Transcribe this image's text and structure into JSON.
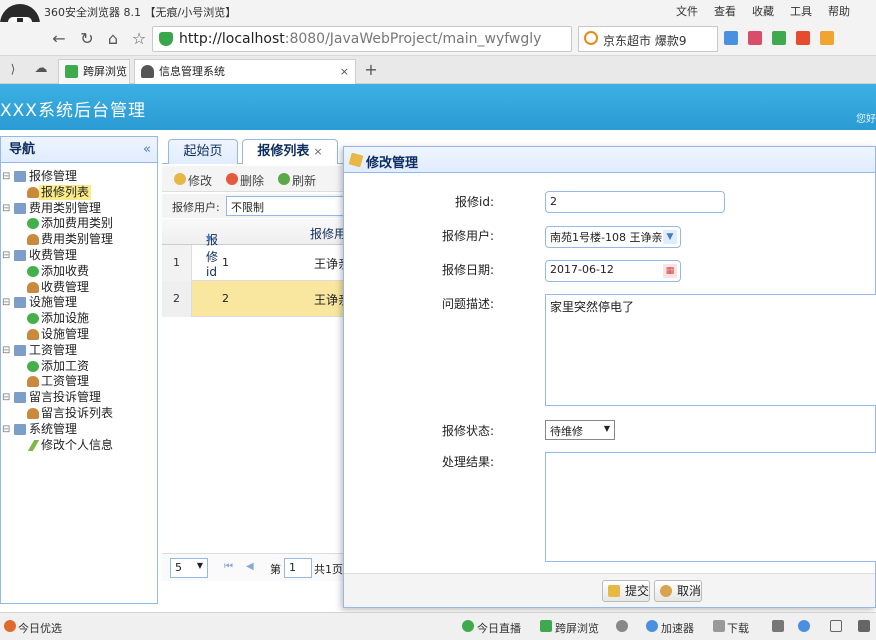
{
  "browser": {
    "title": "360安全浏览器 8.1 【无痕/小号浏览】",
    "menu": [
      "文件",
      "查看",
      "收藏",
      "工具",
      "帮助"
    ],
    "url_host": "http://localhost",
    "url_rest": ":8080/JavaWebProject/main_wyfwgly",
    "search_text": "京东超市 爆款9",
    "tabs": [
      {
        "label": "跨屏浏览"
      },
      {
        "label": "信息管理系统"
      }
    ],
    "new_tab": "+",
    "tab_close": "×"
  },
  "app": {
    "title": "XXX系统后台管理",
    "greeting": "您好"
  },
  "sidebar": {
    "title": "导航",
    "collapse": "«",
    "items": [
      {
        "label": "报修管理",
        "level": 0,
        "icon": "folder"
      },
      {
        "label": "报修列表",
        "level": 1,
        "icon": "user",
        "selected": true
      },
      {
        "label": "费用类别管理",
        "level": 0,
        "icon": "folder"
      },
      {
        "label": "添加费用类别",
        "level": 1,
        "icon": "plus"
      },
      {
        "label": "费用类别管理",
        "level": 1,
        "icon": "user"
      },
      {
        "label": "收费管理",
        "level": 0,
        "icon": "folder"
      },
      {
        "label": "添加收费",
        "level": 1,
        "icon": "plus"
      },
      {
        "label": "收费管理",
        "level": 1,
        "icon": "user"
      },
      {
        "label": "设施管理",
        "level": 0,
        "icon": "folder"
      },
      {
        "label": "添加设施",
        "level": 1,
        "icon": "plus"
      },
      {
        "label": "设施管理",
        "level": 1,
        "icon": "user"
      },
      {
        "label": "工资管理",
        "level": 0,
        "icon": "folder"
      },
      {
        "label": "添加工资",
        "level": 1,
        "icon": "plus"
      },
      {
        "label": "工资管理",
        "level": 1,
        "icon": "user"
      },
      {
        "label": "留言投诉管理",
        "level": 0,
        "icon": "folder"
      },
      {
        "label": "留言投诉列表",
        "level": 1,
        "icon": "user"
      },
      {
        "label": "系统管理",
        "level": 0,
        "icon": "folder"
      },
      {
        "label": "修改个人信息",
        "level": 1,
        "icon": "pen"
      }
    ]
  },
  "main": {
    "tabs": [
      {
        "label": "起始页"
      },
      {
        "label": "报修列表",
        "close": "×"
      }
    ],
    "toolbar": {
      "edit": "修改",
      "delete": "删除",
      "refresh": "刷新"
    },
    "filter": {
      "label": "报修用户:",
      "value": "不限制"
    },
    "grid": {
      "col_id": "报修id",
      "col_user": "报修用",
      "sort_arrow": "▾",
      "rows": [
        {
          "rn": "1",
          "id": "1",
          "user": "王诤亲"
        },
        {
          "rn": "2",
          "id": "2",
          "user": "王诤亲"
        }
      ]
    },
    "pager": {
      "size": "5",
      "page_label": "第",
      "page": "1",
      "total": "共1页"
    }
  },
  "dialog": {
    "title": "修改管理",
    "fields": {
      "id_label": "报修id:",
      "id_value": "2",
      "user_label": "报修用户:",
      "user_value": "南苑1号楼-108 王诤亲",
      "date_label": "报修日期:",
      "date_value": "2017-06-12",
      "desc_label": "问题描述:",
      "desc_value": "家里突然停电了",
      "state_label": "报修状态:",
      "state_value": "待维修",
      "result_label": "处理结果:",
      "result_value": ""
    },
    "submit": "提交",
    "cancel": "取消"
  },
  "statusbar": {
    "left": "今日优选",
    "live": "今日直播",
    "cross": "跨屏浏览",
    "accel": "加速器",
    "download": "下载"
  },
  "colors": {
    "header": "#2a9bd3",
    "border": "#95b8e7",
    "selected_row": "#f9e7a0"
  }
}
